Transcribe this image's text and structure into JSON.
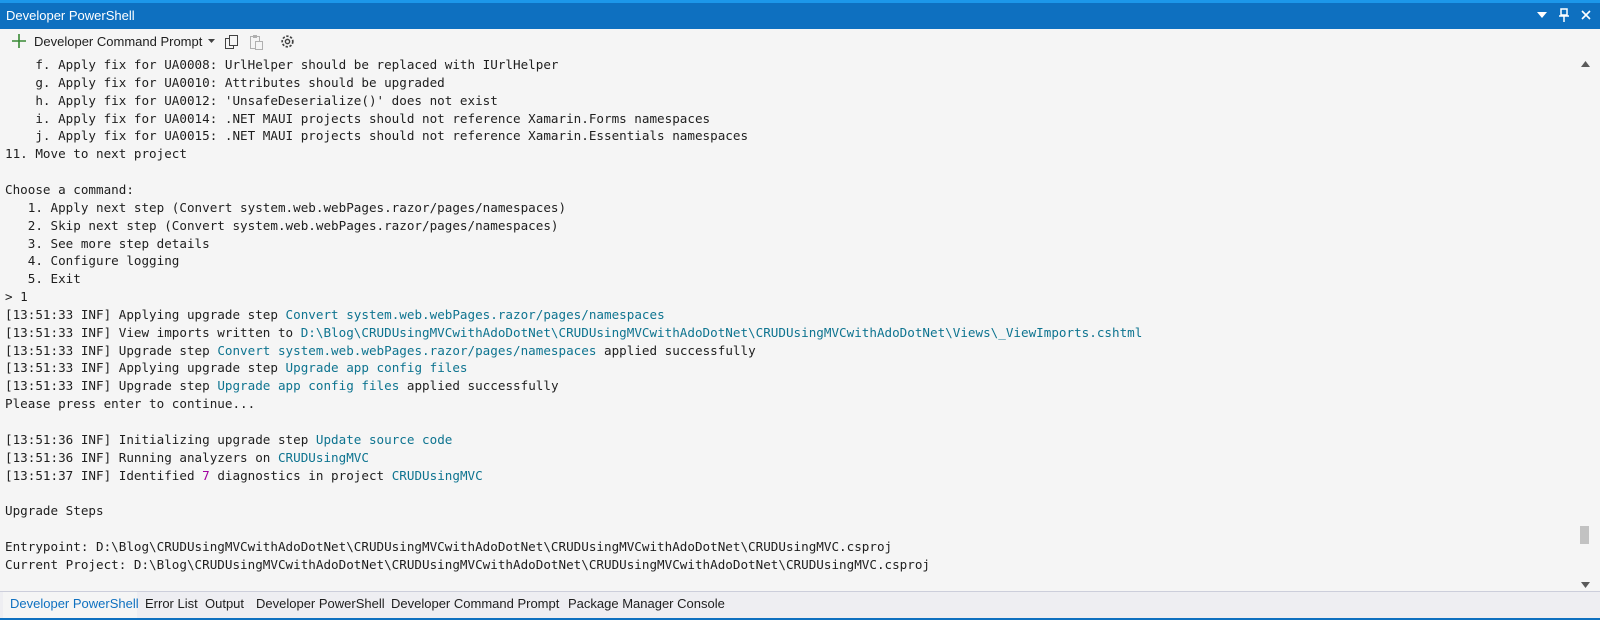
{
  "window": {
    "title": "Developer PowerShell"
  },
  "toolbar": {
    "new_terminal_label": "Developer Command Prompt"
  },
  "terminal": {
    "lines": [
      [
        {
          "t": "    f. Apply fix for UA0008: UrlHelper should be replaced with IUrlHelper"
        }
      ],
      [
        {
          "t": "    g. Apply fix for UA0010: Attributes should be upgraded"
        }
      ],
      [
        {
          "t": "    h. Apply fix for UA0012: 'UnsafeDeserialize()' does not exist"
        }
      ],
      [
        {
          "t": "    i. Apply fix for UA0014: .NET MAUI projects should not reference Xamarin.Forms namespaces"
        }
      ],
      [
        {
          "t": "    j. Apply fix for UA0015: .NET MAUI projects should not reference Xamarin.Essentials namespaces"
        }
      ],
      [
        {
          "t": "11. Move to next project"
        }
      ],
      [
        {
          "t": ""
        }
      ],
      [
        {
          "t": "Choose a command:"
        }
      ],
      [
        {
          "t": "   1. Apply next step (Convert system.web.webPages.razor/pages/namespaces)"
        }
      ],
      [
        {
          "t": "   2. Skip next step (Convert system.web.webPages.razor/pages/namespaces)"
        }
      ],
      [
        {
          "t": "   3. See more step details"
        }
      ],
      [
        {
          "t": "   4. Configure logging"
        }
      ],
      [
        {
          "t": "   5. Exit"
        }
      ],
      [
        {
          "t": "> 1"
        }
      ],
      [
        {
          "t": "[13:51:33 INF] Applying upgrade step "
        },
        {
          "t": "Convert system.web.webPages.razor/pages/namespaces",
          "c": "hl"
        }
      ],
      [
        {
          "t": "[13:51:33 INF] View imports written to "
        },
        {
          "t": "D:\\Blog\\CRUDUsingMVCwithAdoDotNet\\CRUDUsingMVCwithAdoDotNet\\CRUDUsingMVCwithAdoDotNet\\Views\\_ViewImports.cshtml",
          "c": "hl"
        }
      ],
      [
        {
          "t": "[13:51:33 INF] Upgrade step "
        },
        {
          "t": "Convert system.web.webPages.razor/pages/namespaces",
          "c": "hl"
        },
        {
          "t": " applied successfully"
        }
      ],
      [
        {
          "t": "[13:51:33 INF] Applying upgrade step "
        },
        {
          "t": "Upgrade app config files",
          "c": "hl"
        }
      ],
      [
        {
          "t": "[13:51:33 INF] Upgrade step "
        },
        {
          "t": "Upgrade app config files",
          "c": "hl"
        },
        {
          "t": " applied successfully"
        }
      ],
      [
        {
          "t": "Please press enter to continue..."
        }
      ],
      [
        {
          "t": ""
        }
      ],
      [
        {
          "t": "[13:51:36 INF] Initializing upgrade step "
        },
        {
          "t": "Update source code",
          "c": "hl"
        }
      ],
      [
        {
          "t": "[13:51:36 INF] Running analyzers on "
        },
        {
          "t": "CRUDUsingMVC",
          "c": "hl"
        }
      ],
      [
        {
          "t": "[13:51:37 INF] Identified "
        },
        {
          "t": "7",
          "c": "num"
        },
        {
          "t": " diagnostics in project "
        },
        {
          "t": "CRUDUsingMVC",
          "c": "hl"
        }
      ],
      [
        {
          "t": ""
        }
      ],
      [
        {
          "t": "Upgrade Steps"
        }
      ],
      [
        {
          "t": ""
        }
      ],
      [
        {
          "t": "Entrypoint: D:\\Blog\\CRUDUsingMVCwithAdoDotNet\\CRUDUsingMVCwithAdoDotNet\\CRUDUsingMVCwithAdoDotNet\\CRUDUsingMVC.csproj"
        }
      ],
      [
        {
          "t": "Current Project: D:\\Blog\\CRUDUsingMVCwithAdoDotNet\\CRUDUsingMVCwithAdoDotNet\\CRUDUsingMVCwithAdoDotNet\\CRUDUsingMVC.csproj"
        }
      ]
    ]
  },
  "tabs": [
    {
      "label": "Developer PowerShell",
      "active": true
    },
    {
      "label": "Error List"
    },
    {
      "label": "Output"
    },
    {
      "label": "Developer PowerShell"
    },
    {
      "label": "Developer Command Prompt"
    },
    {
      "label": "Package Manager Console"
    }
  ],
  "colors": {
    "accent": "#0e70c0",
    "link": "#0e7490",
    "number": "#a100a1"
  }
}
